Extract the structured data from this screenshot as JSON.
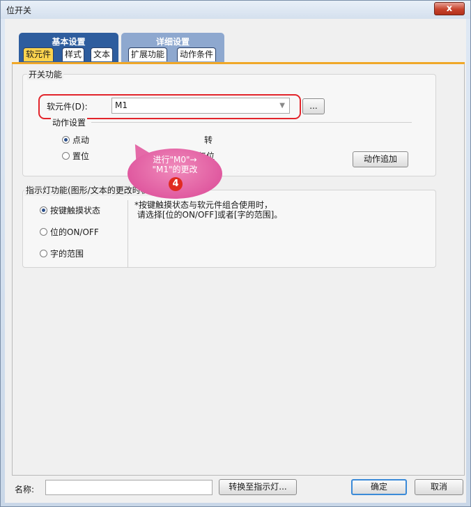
{
  "window": {
    "title": "位开关",
    "close_label": "x"
  },
  "tabs": {
    "basic": {
      "title": "基本设置",
      "subtabs": [
        "软元件",
        "样式",
        "文本"
      ],
      "active": "软元件"
    },
    "detail": {
      "title": "详细设置",
      "subtabs": [
        "扩展功能",
        "动作条件"
      ]
    }
  },
  "switch_function": {
    "group_label": "开关功能",
    "device_label": "软元件(D):",
    "device_value": "M1",
    "browse_label": "...",
    "action_label": "动作设置",
    "radios": [
      {
        "label": "点动",
        "checked": true
      },
      {
        "label": "置位",
        "checked": false
      },
      {
        "label": "反转",
        "checked": false,
        "partial": "转"
      },
      {
        "label": "复位",
        "checked": false,
        "partial": "复位"
      }
    ],
    "add_action_button": "动作追加"
  },
  "indicator_function": {
    "group_label": "指示灯功能(图形/文本的更改时机)",
    "radios": [
      {
        "label": "按键触摸状态",
        "checked": true
      },
      {
        "label": "位的ON/OFF",
        "checked": false
      },
      {
        "label": "字的范围",
        "checked": false
      }
    ],
    "note": "*按键触摸状态与软元件组合使用时，\n 请选择[位的ON/OFF]或者[字的范围]。"
  },
  "annotation": {
    "text": "进行\"M0\"→\n\"M1\"的更改",
    "step": "4"
  },
  "footer": {
    "name_label": "名称:",
    "name_value": "",
    "convert_button": "转换至指示灯...",
    "ok_button": "确定",
    "cancel_button": "取消"
  },
  "colors": {
    "basic_tab_group": "#2e5d9e",
    "detail_tab_group": "#8ea8cf",
    "active_subtab": "#fbd34e",
    "highlight": "#e2242b",
    "callout": "#e05aa0"
  }
}
